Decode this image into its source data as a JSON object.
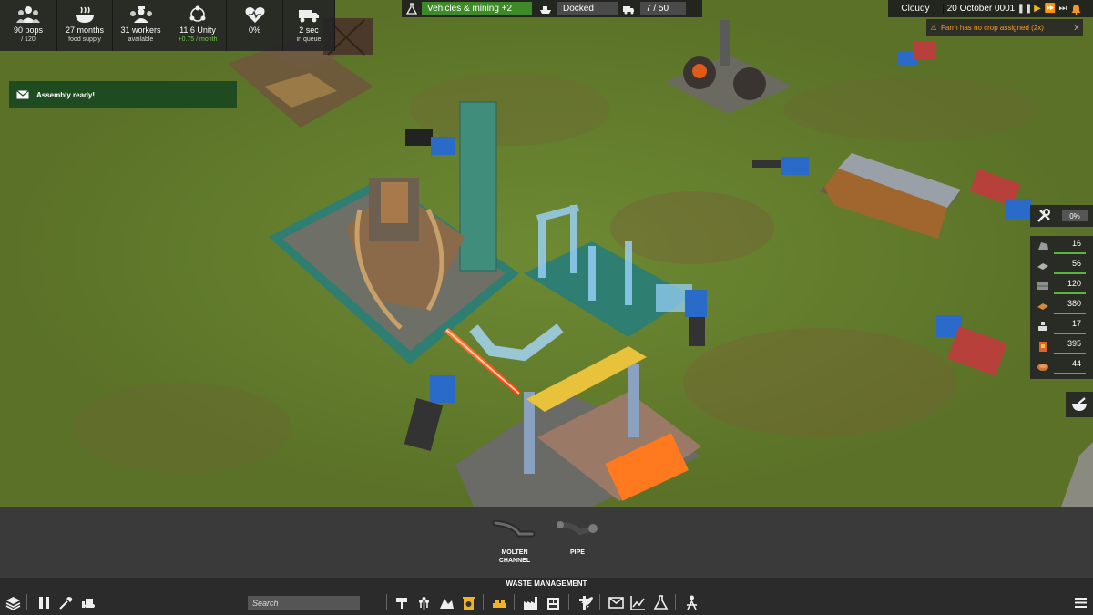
{
  "stats": [
    {
      "icon": "population-icon",
      "value": "90 pops",
      "sub": "/ 120",
      "sub_color": "normal"
    },
    {
      "icon": "food-bowl-icon",
      "value": "27 months",
      "sub": "food supply",
      "sub_color": "normal"
    },
    {
      "icon": "workers-icon",
      "value": "31 workers",
      "sub": "available",
      "sub_color": "normal"
    },
    {
      "icon": "unity-icon",
      "value": "11.6 Unity",
      "sub": "+0.75 / month",
      "sub_color": "green"
    },
    {
      "icon": "health-heart-icon",
      "value": "0%",
      "sub": "",
      "sub_color": "normal"
    },
    {
      "icon": "truck-queue-icon",
      "value": "2 sec",
      "sub": "in queue",
      "sub_color": "normal"
    }
  ],
  "topbar": {
    "research": "Vehicles & mining +2",
    "dock_status": "Docked",
    "vehicles": "7 / 50"
  },
  "time": {
    "weather": "Cloudy",
    "date": "20 October 0001",
    "speed_icons": [
      "pause-icon",
      "play-icon",
      "fast-forward-icon",
      "fastest-forward-icon",
      "alert-bell-icon"
    ]
  },
  "notification": {
    "text": "Farm has no crop assigned (2x)",
    "close": "X"
  },
  "message": {
    "text": "Assembly ready!"
  },
  "maintenance": {
    "value": "0%"
  },
  "resources": [
    {
      "icon": "iron-ore-icon",
      "value": "16",
      "color": "#9a9a9a"
    },
    {
      "icon": "iron-plate-icon",
      "value": "56",
      "color": "#b0b0b0"
    },
    {
      "icon": "steel-ingots-icon",
      "value": "120",
      "color": "#8f8f8f"
    },
    {
      "icon": "wood-planks-icon",
      "value": "380",
      "color": "#d08a3a"
    },
    {
      "icon": "construction-parts-icon",
      "value": "17",
      "color": "#dddddd"
    },
    {
      "icon": "diesel-icon",
      "value": "395",
      "color": "#e0622b"
    },
    {
      "icon": "food-icon",
      "value": "44",
      "color": "#c8763a"
    }
  ],
  "build_panel": {
    "items": [
      {
        "label_line1": "MOLTEN",
        "label_line2": "CHANNEL"
      },
      {
        "label_line1": "PIPE",
        "label_line2": ""
      }
    ],
    "category": "WASTE MANAGEMENT"
  },
  "toolbar": {
    "search_placeholder": "Search",
    "left_icons": [
      "layers-icon",
      "pause-build-icon",
      "eyedropper-icon",
      "bulldozer-icon"
    ],
    "center_icons": [
      "mining-icon",
      "farming-icon",
      "food-processing-icon",
      "waste-management-icon",
      "conveyor-icon",
      "factory-icon",
      "storage-icon",
      "logistics-icon",
      "rocket-icon",
      "mail-icon",
      "stats-chart-icon",
      "research-flask-icon",
      "population-tree-icon"
    ],
    "menu_icon": "hamburger-menu-icon"
  }
}
